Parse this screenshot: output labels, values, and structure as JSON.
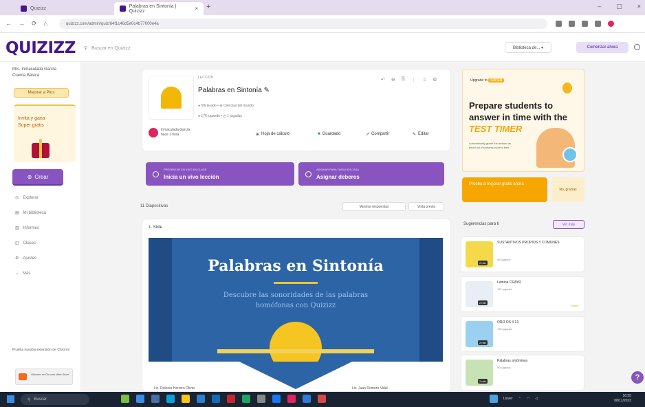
{
  "browser": {
    "tabs": [
      {
        "title": "Quizizz",
        "close": "×"
      },
      {
        "title": "Palabras en Sintonía | Quizizz",
        "close": "×"
      }
    ],
    "new_tab": "+",
    "window_controls": [
      "–",
      "▢",
      "×"
    ],
    "nav": [
      "←",
      "→",
      "⟳",
      "⌂"
    ],
    "url": "quizizz.com/admin/quiz/64f1c46d5e0c4b77000e4a"
  },
  "header": {
    "logo": "QUIZIZZ",
    "search_placeholder": "Buscar en Quizizz",
    "library_select": "Biblioteca de... ▾",
    "signin": "Comenzar ahora"
  },
  "sidebar": {
    "user": "Mrs. Inmaculada García",
    "user_sub": "Cuenta Básica",
    "upgrade": "Mejorar a Plus",
    "promo": "Invita y gana Super gratis",
    "create": "Crear",
    "nav": [
      "Explorar",
      "Mi biblioteca",
      "Informes",
      "Clases",
      "Ajustes",
      "Más"
    ],
    "footer": "Prueba nuestra extensión de Chrome",
    "footer_card": "Obtener en Chrome Web Store"
  },
  "quiz": {
    "tag": "LECCIÓN",
    "title": "Palabras en Sintonía ✎",
    "meta1": "● 5th Grado  •  ☰ Ciencias del mundo",
    "meta2": "● 176 jugando  •  ◷ 1 jugadas",
    "tools": [
      "↶",
      "⊕",
      "⎘",
      "⋮",
      "⇩",
      "⚙"
    ],
    "author": "Inmaculada García",
    "author_time": "hace 1 hora",
    "btn_sheet": "Hoja de cálculo",
    "btn_save": "Guardado",
    "btn_share": "Compartir",
    "btn_edit": "Editar",
    "act_lesson_sub": "PRESENTAR EN VIVO EN CLASE",
    "act_lesson": "Inicia un vivo lección",
    "act_assign_sub": "ASIGNAR PARA TAREA EN CASA",
    "act_assign": "Asignar deberes",
    "slides_count": "11 Diapositivas",
    "show_answers": "Mostrar respuestas",
    "preview": "Vista previa",
    "slide_label": "1. Slide",
    "slide_title": "Palabras en Sintonía",
    "slide_sub": "Descubre las sonoridades de las palabras homófonas con Quizizz",
    "credit_l": "Lic. Dolores Herrero Olivar",
    "credit_r": "Lic. Juan Romero Vidal"
  },
  "ad": {
    "upgrade": "Upgrade to",
    "badge": "SUPER",
    "title_a": "Prepare students to answer in time with the",
    "title_hl": "TEST TIMER",
    "desc": "Automatically grade the answer as timed out if students exceed time",
    "try_btn": "Prueba a mejorar gratis ahora",
    "no_btn": "No, gracias"
  },
  "suggestions": {
    "title": "Sugerencias para ti",
    "see_more": "Ver más",
    "items": [
      {
        "title": "SUSTANTIVOS PROPIOS Y COMUNES",
        "players": "90 jugados",
        "dur": "2 min",
        "color": "#f4d94a"
      },
      {
        "title": "Lámina CRAYR",
        "players": "181 jugados",
        "dur": "2 min",
        "color": "#e8eef4",
        "acc": "Editar"
      },
      {
        "title": "ORO OS II 13",
        "players": "130 jugados",
        "dur": "2 min",
        "color": "#9ad0f0"
      },
      {
        "title": "Palabras antónimas",
        "players": "90 jugados",
        "dur": "2 min",
        "color": "#c7e3b5"
      }
    ]
  },
  "help": "?",
  "taskbar": {
    "search": "Buscar",
    "tray": "Llover",
    "time": "16:55",
    "date": "08/11/2023"
  },
  "colors": {
    "brand": "#46178f",
    "accent": "#8854c0",
    "slide": "#2c64a6",
    "orange": "#f7a600"
  }
}
